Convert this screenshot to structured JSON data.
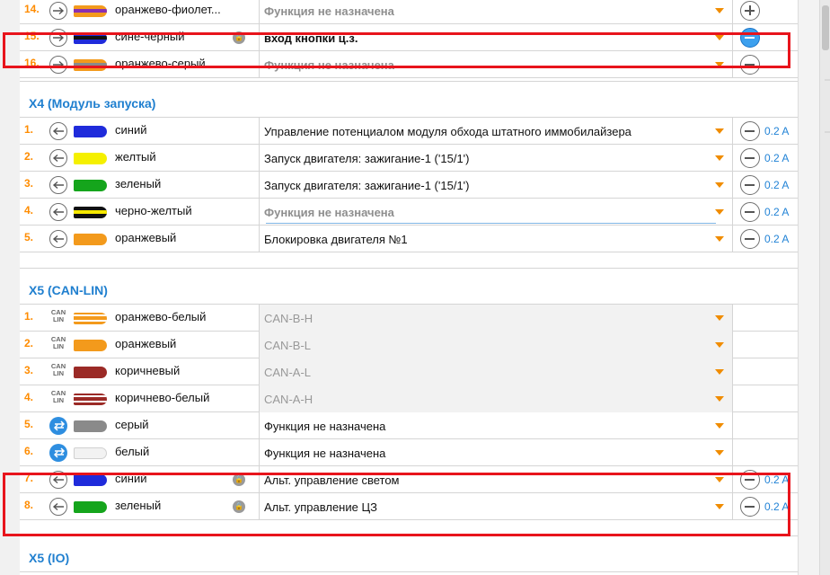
{
  "top_rows": [
    {
      "num": "14.",
      "dir": "out",
      "wire": {
        "color": "#f39a1c",
        "stripe": "#8a2fb0"
      },
      "name": "оранжево-фиолет...",
      "function": "Функция не назначена",
      "func_style": "unassigned",
      "action": "plus",
      "amp": "",
      "lock": false
    },
    {
      "num": "15.",
      "dir": "out",
      "wire": {
        "color": "#1f2bdb",
        "stripe": "#111111"
      },
      "name": "сине-черный",
      "function": "вход кнопки ц.з.",
      "func_style": "bold",
      "action": "minus-active",
      "amp": "",
      "lock": true
    },
    {
      "num": "16.",
      "dir": "out",
      "wire": {
        "color": "#f39a1c",
        "stripe": "#8a8a8a"
      },
      "name": "оранжево-серый",
      "function": "Функция не назначена",
      "func_style": "unassigned",
      "action": "minus",
      "amp": "",
      "lock": false
    }
  ],
  "sections": [
    {
      "title": "X4 (Модуль запуска)",
      "rows": [
        {
          "num": "1.",
          "dir": "in",
          "wire": {
            "color": "#1f2bdb",
            "stripe": ""
          },
          "name": "синий",
          "function": "Управление потенциалом модуля обхода штатного иммобилайзера",
          "func_style": "",
          "action": "minus",
          "amp": "0.2 A",
          "lock": false
        },
        {
          "num": "2.",
          "dir": "in",
          "wire": {
            "color": "#f5f000",
            "stripe": ""
          },
          "name": "желтый",
          "function": "Запуск двигателя: зажигание-1 ('15/1')",
          "func_style": "",
          "action": "minus",
          "amp": "0.2 A",
          "lock": false
        },
        {
          "num": "3.",
          "dir": "in",
          "wire": {
            "color": "#15a51c",
            "stripe": ""
          },
          "name": "зеленый",
          "function": "Запуск двигателя: зажигание-1 ('15/1')",
          "func_style": "",
          "action": "minus",
          "amp": "0.2 A",
          "lock": false
        },
        {
          "num": "4.",
          "dir": "in",
          "wire": {
            "color": "#111111",
            "stripe": "#f5e800"
          },
          "name": "черно-желтый",
          "function": "Функция не назначена",
          "func_style": "unassigned",
          "action": "minus",
          "amp": "0.2 A",
          "lock": false,
          "underline": true
        },
        {
          "num": "5.",
          "dir": "in",
          "wire": {
            "color": "#f39a1c",
            "stripe": ""
          },
          "name": "оранжевый",
          "function": "Блокировка двигателя №1",
          "func_style": "",
          "action": "minus",
          "amp": "0.2 A",
          "lock": false
        }
      ]
    },
    {
      "title": "X5 (CAN-LIN)",
      "rows": [
        {
          "num": "1.",
          "dir": "can",
          "wire": {
            "color": "#f39a1c",
            "stripe": "#ffffff"
          },
          "name": "оранжево-белый",
          "function": "CAN-B-H",
          "func_style": "disabled",
          "action": "",
          "amp": "",
          "lock": false
        },
        {
          "num": "2.",
          "dir": "can",
          "wire": {
            "color": "#f39a1c",
            "stripe": ""
          },
          "name": "оранжевый",
          "function": "CAN-B-L",
          "func_style": "disabled",
          "action": "",
          "amp": "",
          "lock": false
        },
        {
          "num": "3.",
          "dir": "can",
          "wire": {
            "color": "#9b2a26",
            "stripe": ""
          },
          "name": "коричневый",
          "function": "CAN-A-L",
          "func_style": "disabled",
          "action": "",
          "amp": "",
          "lock": false
        },
        {
          "num": "4.",
          "dir": "can",
          "wire": {
            "color": "#9b2a26",
            "stripe": "#ffffff"
          },
          "name": "коричнево-белый",
          "function": "CAN-A-H",
          "func_style": "disabled",
          "action": "",
          "amp": "",
          "lock": false
        },
        {
          "num": "5.",
          "dir": "sw",
          "wire": {
            "color": "#8a8a8a",
            "stripe": ""
          },
          "name": "серый",
          "function": "Функция не назначена",
          "func_style": "",
          "action": "",
          "amp": "",
          "lock": false
        },
        {
          "num": "6.",
          "dir": "sw",
          "wire": {
            "color": "#f2f2f2",
            "stripe": ""
          },
          "name": "белый",
          "function": "Функция не назначена",
          "func_style": "",
          "action": "",
          "amp": "",
          "lock": false
        },
        {
          "num": "7.",
          "dir": "in",
          "wire": {
            "color": "#1f2bdb",
            "stripe": ""
          },
          "name": "синий",
          "function": "Альт. управление светом",
          "func_style": "",
          "action": "minus",
          "amp": "0.2 A",
          "lock": true
        },
        {
          "num": "8.",
          "dir": "in",
          "wire": {
            "color": "#15a51c",
            "stripe": ""
          },
          "name": "зеленый",
          "function": "Альт. управление ЦЗ",
          "func_style": "",
          "action": "minus",
          "amp": "0.2 A",
          "lock": true
        }
      ]
    },
    {
      "title": "X5 (IO)",
      "rows": []
    }
  ],
  "can_label": {
    "line1": "CAN",
    "line2": "LIN"
  },
  "lock_glyph": "🔒",
  "icons": {
    "direction_out": "arrow-right-circle-icon",
    "direction_in": "arrow-left-circle-icon",
    "switch": "swap-arrows-icon",
    "add": "plus-circle-icon",
    "remove": "minus-circle-icon",
    "lock": "lock-icon"
  },
  "colors": {
    "number": "#ff8c00",
    "section_title": "#1f7fcf",
    "amp": "#2283d6",
    "dropdown_arrow": "#f08c00",
    "highlight": "#e8141c"
  }
}
